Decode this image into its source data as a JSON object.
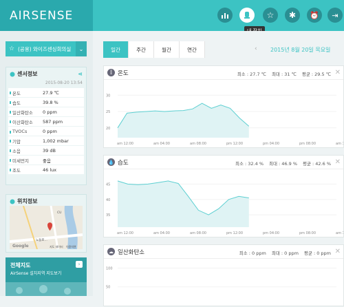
{
  "header": {
    "logo": "AIRSENSE",
    "tooltip": "내 장치",
    "icons": [
      "chart-icon",
      "device-icon",
      "star-icon",
      "gear-icon",
      "alarm-icon",
      "logout-icon"
    ]
  },
  "sidebar": {
    "favorite_label": "(공용) 와이즈센싱회의실",
    "sensor_title": "센서정보",
    "sensor_date": "2015-08-20 13:54",
    "sensor_rows": [
      {
        "k": "온도",
        "v": "27.9 ℃"
      },
      {
        "k": "습도",
        "v": "39.8 %"
      },
      {
        "k": "일산화탄소",
        "v": "0 ppm"
      },
      {
        "k": "이산화탄소",
        "v": "587 ppm"
      },
      {
        "k": "TVOCs",
        "v": "0 ppm"
      },
      {
        "k": "기압",
        "v": "1,002 mbar"
      },
      {
        "k": "소음",
        "v": "39 dB"
      },
      {
        "k": "미세먼지",
        "v": "좋음"
      },
      {
        "k": "조도",
        "v": "46 lux"
      }
    ],
    "location_title": "위치정보",
    "map_labels": {
      "place": "노들로…",
      "google": "Google",
      "data": "지도 데이터",
      "terms": "이용약관",
      "cu": "CU"
    },
    "full_map_title": "전체지도",
    "full_map_sub": "AirSense 설치지역 지도보기"
  },
  "main": {
    "tabs": [
      "일간",
      "주간",
      "월간",
      "연간"
    ],
    "active_tab": 0,
    "date": "2015년 8월 20일 목요일",
    "x_ticks": [
      "am 12:00",
      "am 04:00",
      "am 08:00",
      "pm 12:00",
      "pm 04:00",
      "pm 08:00",
      "am 12:00"
    ]
  },
  "cards": [
    {
      "title": "온도",
      "min": "최소 : 27.7 ℃",
      "max": "최대 : 31 ℃",
      "avg": "평균 : 29.5 ℃"
    },
    {
      "title": "습도",
      "min": "최소 : 32.4 %",
      "max": "최대 : 46.9 %",
      "avg": "평균 : 42.6 %"
    },
    {
      "title": "일산화탄소",
      "min": "최소 : 0 ppm",
      "max": "최대 : 0 ppm",
      "avg": "평균 : 0 ppm"
    }
  ],
  "chart_data": [
    {
      "type": "area",
      "title": "온도",
      "x": [
        "am 12:00",
        "am 04:00",
        "am 08:00",
        "pm 12:00",
        "pm 04:00",
        "pm 08:00",
        "am 12:00"
      ],
      "y_ticks": [
        20,
        25,
        30
      ],
      "ylim": [
        17,
        33
      ],
      "series": [
        {
          "values": [
            20,
            24.5,
            24.8,
            25,
            25.2,
            25,
            25.2,
            25.3,
            25.8,
            27.5,
            26,
            27,
            26,
            23,
            20.5
          ]
        }
      ]
    },
    {
      "type": "area",
      "title": "습도",
      "x": [
        "am 12:00",
        "am 04:00",
        "am 08:00",
        "pm 12:00",
        "pm 04:00",
        "pm 08:00",
        "am 12:00"
      ],
      "y_ticks": [
        35,
        40,
        45
      ],
      "ylim": [
        31,
        48
      ],
      "series": [
        {
          "values": [
            46,
            45,
            44.8,
            45,
            45.5,
            46,
            45.2,
            41,
            36.5,
            35,
            37,
            40,
            41,
            40.5
          ]
        }
      ]
    },
    {
      "type": "line",
      "title": "일산화탄소",
      "y_ticks": [
        50,
        100
      ],
      "ylim": [
        0,
        110
      ],
      "series": [
        {
          "values": []
        }
      ]
    }
  ],
  "colors": {
    "accent": "#3cc3c3",
    "fill": "#dff3f4",
    "line": "#5ccfd1"
  }
}
